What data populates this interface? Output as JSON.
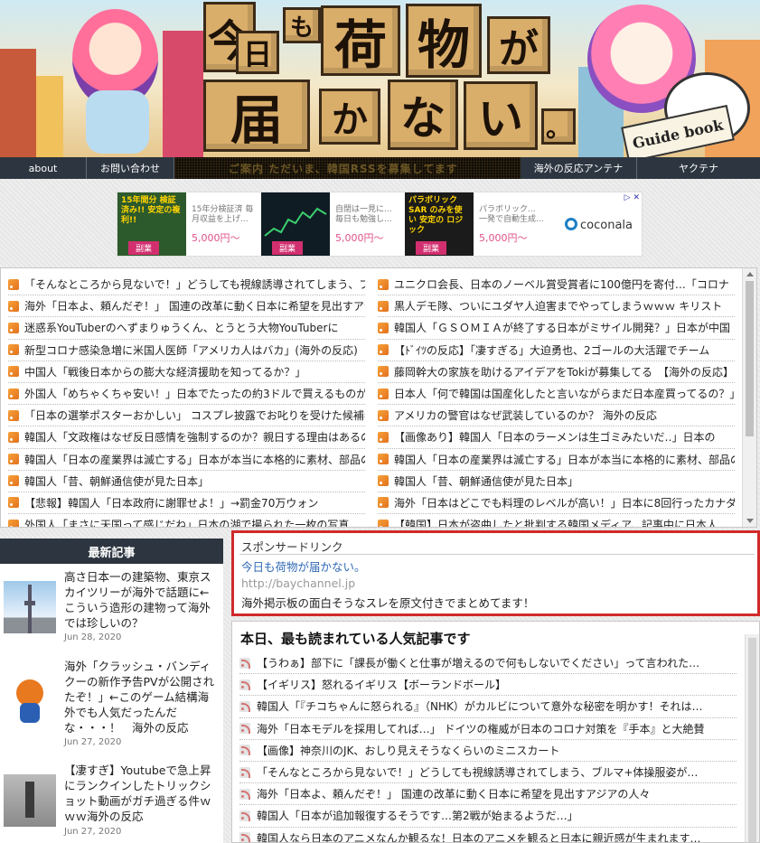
{
  "colors": {
    "nav_bg": "#2d3640",
    "sponsor_border": "#d12a2a",
    "link_blue": "#2f69b5",
    "rss_orange": "#f08a2b",
    "price_pink": "#e0508a"
  },
  "banner": {
    "logo_chars": [
      "今",
      "日",
      "も",
      "荷",
      "物",
      "が",
      "届",
      "か",
      "な",
      "い",
      "。"
    ],
    "book_text": "Guide book"
  },
  "nav": {
    "items": [
      "about",
      "お問い合わせ",
      "海外の反応アンテナ",
      "ヤクテナ"
    ],
    "ticker": "ご案内    ただいま、韓国RSSを募集してます"
  },
  "ads": [
    {
      "title_text": "15年間分 検証済み!! 安定の複利!!",
      "desc": "15年分検証済 毎月収益を上げ...",
      "price": "5,000円〜",
      "tag": "副業"
    },
    {
      "title_text": "",
      "desc": "自閉は一見に... 毎日も勉強し...",
      "price": "5,000円〜",
      "tag": "副業"
    },
    {
      "title_text": "パラボリックSAR のみを使い 安定の ロジック",
      "desc": "パラボリック... 一発で自動生成...",
      "price": "5,000円〜",
      "tag": "副業"
    },
    {
      "title_text": "coconala",
      "desc": "",
      "price": "",
      "tag": ""
    }
  ],
  "rss": {
    "left": [
      "「そんなところから見ないで！」どうしても視線誘導されてしまう、ブルマ+体操服",
      "海外「日本よ、頼んだぞ！」 国連の改革に動く日本に希望を見出すアジアの人々",
      "迷惑系YouTuberのへずまりゅうくん、とうとう大物YouTuberに",
      "新型コロナ感染急増に米国人医師「アメリカ人はバカ」(海外の反応)",
      "中国人「戦後日本からの膨大な経済援助を知ってるか？」",
      "外国人「めちゃくちゃ安い！」日本でたったの約3ドルで買えるものが凄い",
      "「日本の選挙ポスターおかしい」 コスプレ披露でお叱りを受けた候補者",
      "韓国人「文政権はなぜ反日感情を強制するのか？親日する理由はあるのに」",
      "韓国人「日本の産業界は滅亡する」日本が本当に本格的に素材、部品の",
      "韓国人「昔、朝鮮通信使が見た日本」",
      "【悲報】韓国人「日本政府に謝罪せよ！」→罰金70万ウォン",
      "外国人「まさに天国って感じだね」日本の湖で撮られた一枚の写真"
    ],
    "right": [
      "ユニクロ会長、日本のノーベル賞受賞者に100億円を寄付…「コロナ",
      "黒人デモ隊、ついにユダヤ人迫害までやってしまうｗｗｗ キリスト",
      "韓国人「ＧＳＯＭＩＡが終了する日本がミサイル開発？」日本が中国",
      "【ﾄﾞｲﾂの反応】「凄すぎる」大迫勇也、2ゴールの大活躍でチーム",
      "藤岡幹大の家族を助けるアイデアをTokiが募集してる　【海外の反応】",
      "日本人「何で韓国は国産化したと言いながらまだ日本産買ってるの？」",
      "アメリカの警官はなぜ武装しているのか？ 海外の反応",
      "【画像あり】韓国人「日本のラーメンは生ゴミみたいだ‥」日本の",
      "韓国人「日本の産業界は滅亡する」日本が本当に本格的に素材、部品の",
      "韓国人「昔、朝鮮通信使が見た日本」",
      "海外「日本はどこでも料理のレベルが高い！」日本に8回行ったカナダ",
      "【韓国】日本が盗曲したと批判する韓国メディア、記事中に日本人"
    ]
  },
  "sidebar": {
    "heading": "最新記事",
    "items": [
      {
        "title": "高さ日本一の建築物、東京スカイツリーが海外で話題に←こういう造形の建物って海外では珍しいの？",
        "date": "Jun 28, 2020",
        "thumb": "skytree-photo"
      },
      {
        "title": "海外「クラッシュ・バンディクーの新作予告PVが公開されたぞ！」←このゲーム結構海外でも人気だったんだな・・・！　海外の反応",
        "date": "Jun 27, 2020",
        "thumb": "crash-bandicoot-image"
      },
      {
        "title": "【凄すぎ】Youtubeで急上昇にランクインしたトリックショット動画がガチ過ぎる件ｗｗｗ海外の反応",
        "date": "Jun 27, 2020",
        "thumb": "trick-shot-photo"
      }
    ]
  },
  "sponsor": {
    "label": "スポンサードリンク",
    "site_name": "今日も荷物が届かない。",
    "url": "http://baychannel.jp",
    "desc": "海外掲示板の面白そうなスレを原文付きでまとめてます！"
  },
  "popular": {
    "heading": "本日、最も読まれている人気記事です",
    "items": [
      "【うわぁ】部下に「課長が働くと仕事が増えるので何もしないでください」って言われた…",
      "【イギリス】怒れるイギリス【ボーランドボール】",
      "韓国人「『チコちゃんに怒られる』（NHK）がカルビについて意外な秘密を明かす！それは…",
      "海外「日本モデルを採用してれば…」 ドイツの権威が日本のコロナ対策を『手本』と大絶賛",
      "【画像】神奈川のJK、おしり見えそうなくらいのミニスカート",
      "「そんなところから見ないで！」どうしても視線誘導されてしまう、ブルマ+体操服姿が…",
      "海外「日本よ、頼んだぞ！」 国連の改革に動く日本に希望を見出すアジアの人々",
      "韓国人「日本が追加報復するそうです…第2戦が始まるようだ…」",
      "韓国人なら日本のアニメなんか観るな！日本のアニメを観ると日本に親近感が生まれます…"
    ]
  }
}
